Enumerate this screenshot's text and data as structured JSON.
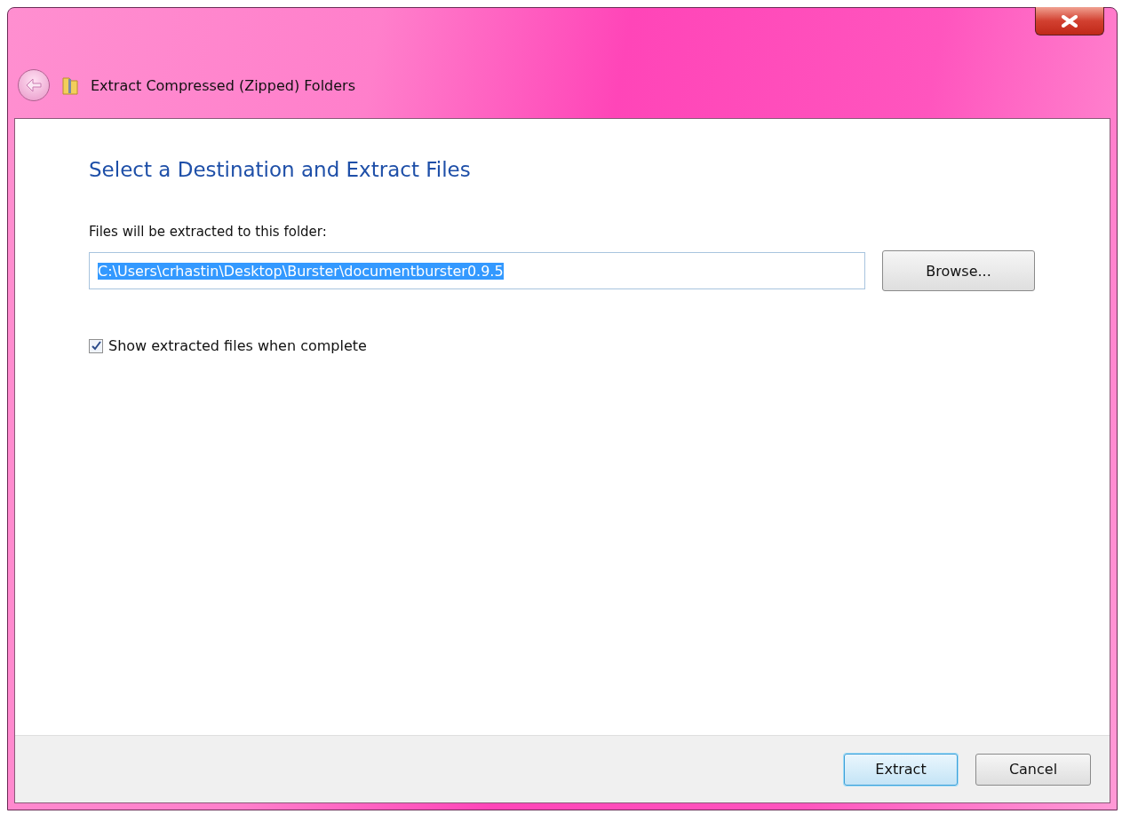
{
  "window": {
    "title": "Extract Compressed (Zipped) Folders"
  },
  "heading": "Select a Destination and Extract Files",
  "destination": {
    "label": "Files will be extracted to this folder:",
    "value": "C:\\Users\\crhastin\\Desktop\\Burster\\documentburster0.9.5",
    "selected": true,
    "browse": "Browse..."
  },
  "option": {
    "label": "Show extracted files when complete",
    "checked": true
  },
  "buttons": [
    {
      "label": "Extract",
      "default": true
    },
    {
      "label": "Cancel",
      "default": false
    }
  ]
}
